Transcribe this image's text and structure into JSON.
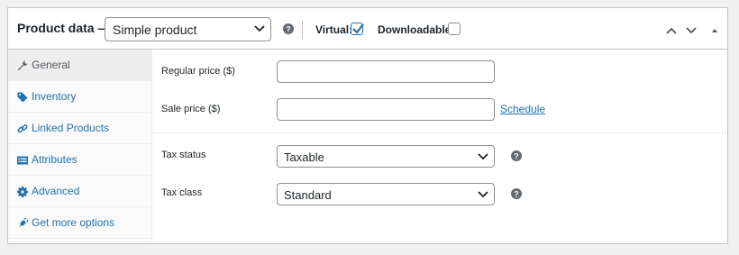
{
  "header": {
    "title": "Product data —",
    "product_type": "Simple product",
    "virtual_label": "Virtual:",
    "virtual_checked": true,
    "downloadable_label": "Downloadable:",
    "downloadable_checked": false
  },
  "tabs": [
    {
      "label": "General",
      "icon": "wrench-icon",
      "active": true
    },
    {
      "label": "Inventory",
      "icon": "tag-icon",
      "active": false
    },
    {
      "label": "Linked Products",
      "icon": "link-icon",
      "active": false
    },
    {
      "label": "Attributes",
      "icon": "list-icon",
      "active": false
    },
    {
      "label": "Advanced",
      "icon": "gear-icon",
      "active": false
    },
    {
      "label": "Get more options",
      "icon": "plugin-icon",
      "active": false
    }
  ],
  "general": {
    "regular_price_label": "Regular price ($)",
    "regular_price_value": "",
    "sale_price_label": "Sale price ($)",
    "sale_price_value": "",
    "schedule_link": "Schedule",
    "tax_status_label": "Tax status",
    "tax_status_value": "Taxable",
    "tax_class_label": "Tax class",
    "tax_class_value": "Standard"
  },
  "colors": {
    "link": "#2271b1",
    "border": "#c3c4c7",
    "background": "#f0f0f1"
  }
}
